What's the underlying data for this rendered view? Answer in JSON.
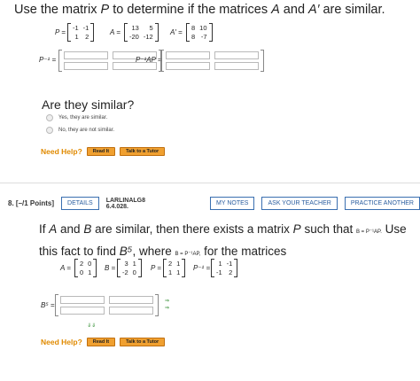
{
  "question_top": {
    "title_parts": [
      "Use the matrix ",
      "P",
      " to determine if the matrices ",
      "A",
      " and ",
      "A′",
      " are similar."
    ],
    "matrices": {
      "P": {
        "label": "P =",
        "rows": [
          [
            "-1",
            "-1"
          ],
          [
            "1",
            "2"
          ]
        ]
      },
      "A": {
        "label": "A =",
        "rows": [
          [
            "13",
            "5"
          ],
          [
            "-20",
            "-12"
          ]
        ]
      },
      "A_prime": {
        "label": "A′ =",
        "rows": [
          [
            "8",
            "10"
          ],
          [
            "8",
            "-7"
          ]
        ]
      }
    },
    "answer_labels": {
      "p_inverse": "P⁻¹ =",
      "p_inv_a_p": "P⁻¹AP ="
    },
    "are_similar": "Are they similar?",
    "options": [
      "Yes, they are similar.",
      "No, they are not similar."
    ],
    "need_help": "Need Help?",
    "read_it": "Read It",
    "talk_tutor": "Talk to a Tutor"
  },
  "question_8": {
    "number": "8.",
    "points": "[–/1 Points]",
    "details": "DETAILS",
    "code": "LARLINALG8 6.4.028.",
    "my_notes": "MY NOTES",
    "ask_teacher": "ASK YOUR TEACHER",
    "practice": "PRACTICE ANOTHER",
    "body_line1_parts": [
      "If ",
      "A",
      " and ",
      "B",
      " are similar, then there exists a matrix ",
      "P",
      " such that ",
      "B = P⁻¹AP.",
      " Use"
    ],
    "body_line2_parts": [
      "this fact to find ",
      "B⁵",
      ", where ",
      "B = P⁻¹AP,",
      " for the matrices"
    ],
    "matrices": {
      "A": {
        "label": "A =",
        "rows": [
          [
            "2",
            "0"
          ],
          [
            "0",
            "1"
          ]
        ]
      },
      "B": {
        "label": "B =",
        "rows": [
          [
            "3",
            "1"
          ],
          [
            "-2",
            "0"
          ]
        ]
      },
      "P": {
        "label": "P =",
        "rows": [
          [
            "2",
            "1"
          ],
          [
            "1",
            "1"
          ]
        ]
      },
      "P_inverse": {
        "label": "P⁻¹ =",
        "rows": [
          [
            "1",
            "-1"
          ],
          [
            "-1",
            "2"
          ]
        ]
      }
    },
    "b5_label": "B⁵ =",
    "need_help": "Need Help?",
    "read_it": "Read It",
    "talk_tutor": "Talk to a Tutor"
  }
}
